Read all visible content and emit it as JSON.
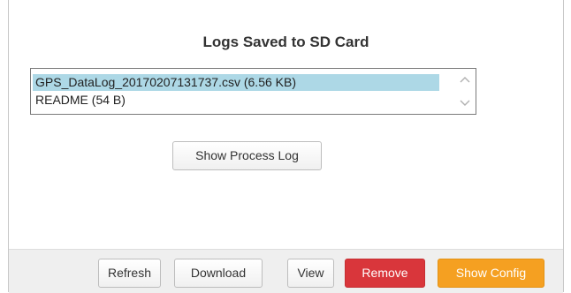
{
  "title": "Logs Saved to SD Card",
  "files": [
    {
      "label": "GPS_DataLog_20170207131737.csv (6.56 KB)",
      "selected": true
    },
    {
      "label": "README (54 B)",
      "selected": false
    }
  ],
  "buttons": {
    "show_process_log": "Show Process Log",
    "refresh": "Refresh",
    "download": "Download",
    "view": "View",
    "remove": "Remove",
    "show_config": "Show Config"
  },
  "colors": {
    "selection": "#add8e6",
    "remove": "#d9363b",
    "show_config": "#f5a021"
  }
}
